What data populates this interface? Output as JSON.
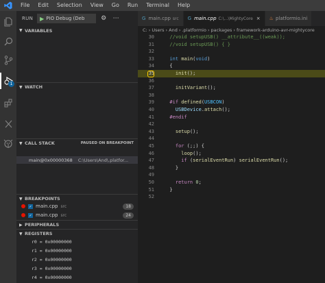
{
  "menu": [
    "File",
    "Edit",
    "Selection",
    "View",
    "Go",
    "Run",
    "Terminal",
    "Help"
  ],
  "activity": {
    "debug_badge": "1"
  },
  "sidebar": {
    "run_label": "RUN",
    "config": "PIO Debug (Deb",
    "sections": {
      "variables": "VARIABLES",
      "watch": "WATCH",
      "call_stack": "CALL STACK",
      "call_stack_status": "PAUSED ON BREAKPOINT",
      "breakpoints": "BREAKPOINTS",
      "peripherals": "PERIPHERALS",
      "registers": "REGISTERS"
    },
    "call_stack_frame": {
      "function": "main@0x00000368",
      "path": "C:\\Users\\And\\.platfor..."
    },
    "breakpoints": [
      {
        "file": "main.cpp",
        "dir": "src",
        "line": "18"
      },
      {
        "file": "main.cpp",
        "dir": "src",
        "line": "24"
      }
    ],
    "registers": [
      "r0 = 0x00000000",
      "r1 = 0x00000000",
      "r2 = 0x00000000",
      "r3 = 0x00000000",
      "r4 = 0x00000000"
    ]
  },
  "editor": {
    "tabs": [
      {
        "name": "main.cpp",
        "dir": "src"
      },
      {
        "name": "main.cpp",
        "dir": "C:\\...\\MightyCore"
      },
      {
        "name": "platformio.ini",
        "dir": ""
      }
    ],
    "breadcrumb": [
      "C:",
      "Users",
      "And",
      ".platformio",
      "packages",
      "framework-arduino-avr-mightycore"
    ],
    "current_line": "35",
    "lines": [
      {
        "n": "30",
        "tokens": [
          [
            "c-com",
            "  //void setupUSB() __attribute__((weak));"
          ]
        ]
      },
      {
        "n": "31",
        "tokens": [
          [
            "c-com",
            "  //void setupUSB() { }"
          ]
        ]
      },
      {
        "n": "32",
        "tokens": []
      },
      {
        "n": "33",
        "tokens": [
          [
            "c-kw",
            "  int "
          ],
          [
            "c-fn",
            "main"
          ],
          [
            "c-txt",
            "("
          ],
          [
            "c-kw",
            "void"
          ],
          [
            "c-txt",
            ")"
          ]
        ]
      },
      {
        "n": "34",
        "tokens": [
          [
            "c-txt",
            "  {"
          ]
        ]
      },
      {
        "n": "35",
        "tokens": [
          [
            "c-fn",
            "    init"
          ],
          [
            "c-txt",
            "();"
          ]
        ]
      },
      {
        "n": "36",
        "tokens": []
      },
      {
        "n": "37",
        "tokens": [
          [
            "c-fn",
            "    initVariant"
          ],
          [
            "c-txt",
            "();"
          ]
        ]
      },
      {
        "n": "38",
        "tokens": []
      },
      {
        "n": "39",
        "tokens": [
          [
            "c-kw2",
            "  #if "
          ],
          [
            "c-fn",
            "defined"
          ],
          [
            "c-txt",
            "("
          ],
          [
            "c-macro",
            "USBCON"
          ],
          [
            "c-txt",
            ")"
          ]
        ]
      },
      {
        "n": "40",
        "tokens": [
          [
            "c-var",
            "    USBDevice"
          ],
          [
            "c-txt",
            "."
          ],
          [
            "c-fn",
            "attach"
          ],
          [
            "c-txt",
            "();"
          ]
        ]
      },
      {
        "n": "41",
        "tokens": [
          [
            "c-kw2",
            "  #endif"
          ]
        ]
      },
      {
        "n": "42",
        "tokens": []
      },
      {
        "n": "43",
        "tokens": [
          [
            "c-fn",
            "    setup"
          ],
          [
            "c-txt",
            "();"
          ]
        ]
      },
      {
        "n": "44",
        "tokens": []
      },
      {
        "n": "45",
        "tokens": [
          [
            "c-kw2",
            "    for "
          ],
          [
            "c-txt",
            "(;;) {"
          ]
        ]
      },
      {
        "n": "46",
        "tokens": [
          [
            "c-fn",
            "      loop"
          ],
          [
            "c-txt",
            "();"
          ]
        ]
      },
      {
        "n": "47",
        "tokens": [
          [
            "c-kw2",
            "      if "
          ],
          [
            "c-txt",
            "("
          ],
          [
            "c-fn",
            "serialEventRun"
          ],
          [
            "c-txt",
            ") "
          ],
          [
            "c-fn",
            "serialEventRun"
          ],
          [
            "c-txt",
            "();"
          ]
        ]
      },
      {
        "n": "48",
        "tokens": [
          [
            "c-txt",
            "    }"
          ]
        ]
      },
      {
        "n": "49",
        "tokens": []
      },
      {
        "n": "50",
        "tokens": [
          [
            "c-kw2",
            "    return "
          ],
          [
            "c-num",
            "0"
          ],
          [
            "c-txt",
            ";"
          ]
        ]
      },
      {
        "n": "51",
        "tokens": [
          [
            "c-txt",
            "  }"
          ]
        ]
      },
      {
        "n": "52",
        "tokens": []
      }
    ]
  }
}
